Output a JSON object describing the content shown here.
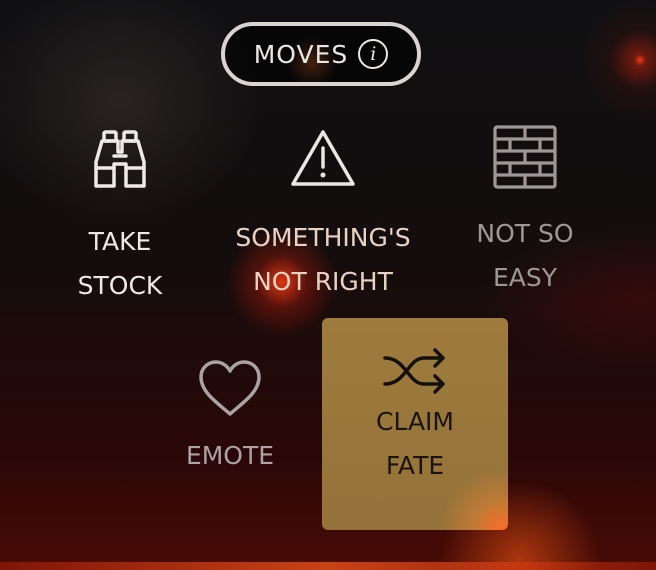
{
  "header": {
    "title": "MOVES",
    "info_glyph": "i"
  },
  "moves": [
    {
      "id": "take-stock",
      "label": "TAKE\nSTOCK",
      "icon": "binoculars-icon",
      "color": "#ece9e6"
    },
    {
      "id": "somethings-not-right",
      "label": "SOMETHING'S\nNOT RIGHT",
      "icon": "warning-icon",
      "color": "#e9d2c3"
    },
    {
      "id": "not-so-easy",
      "label": "NOT SO\nEASY",
      "icon": "brick-wall-icon",
      "color": "#9e9796"
    },
    {
      "id": "emote",
      "label": "EMOTE",
      "icon": "heart-icon",
      "color": "#a9a3a2"
    },
    {
      "id": "claim-fate",
      "label": "CLAIM\nFATE",
      "icon": "shuffle-icon",
      "color": "#1a1410",
      "selected": true,
      "highlight": "#9e7b3c"
    }
  ]
}
